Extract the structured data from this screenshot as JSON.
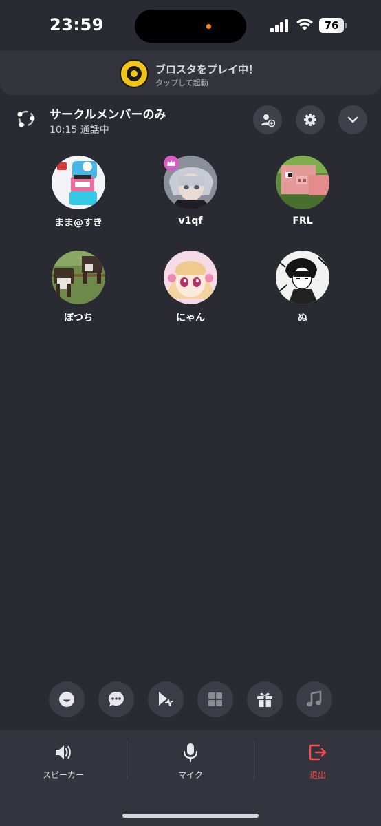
{
  "status_bar": {
    "time": "23:59",
    "battery": "76",
    "battery_level": 0.76
  },
  "banner": {
    "title": "ブロスタをプレイ中！",
    "subtitle": "タップして起動"
  },
  "room": {
    "title": "サークルメンバーのみ",
    "subtitle": "10:15 通話中"
  },
  "header_buttons": [
    "add-member-icon",
    "gear-icon",
    "chevron-down-icon"
  ],
  "members": [
    {
      "name": "まま@すき"
    },
    {
      "name": "v1qf",
      "host": true
    },
    {
      "name": "FRL"
    },
    {
      "name": "ぼつち"
    },
    {
      "name": "にゃん"
    },
    {
      "name": "ぬ"
    }
  ],
  "actions": [
    "smile-icon",
    "chat-icon",
    "voice-effect-icon",
    "grid-icon",
    "gift-icon",
    "music-icon"
  ],
  "bottom_bar": {
    "speaker_label": "スピーカー",
    "mic_label": "マイク",
    "leave_label": "退出"
  },
  "colors": {
    "background": "#2a2a33",
    "leave": "#ff4b4b",
    "crown": "#d85cc6"
  }
}
